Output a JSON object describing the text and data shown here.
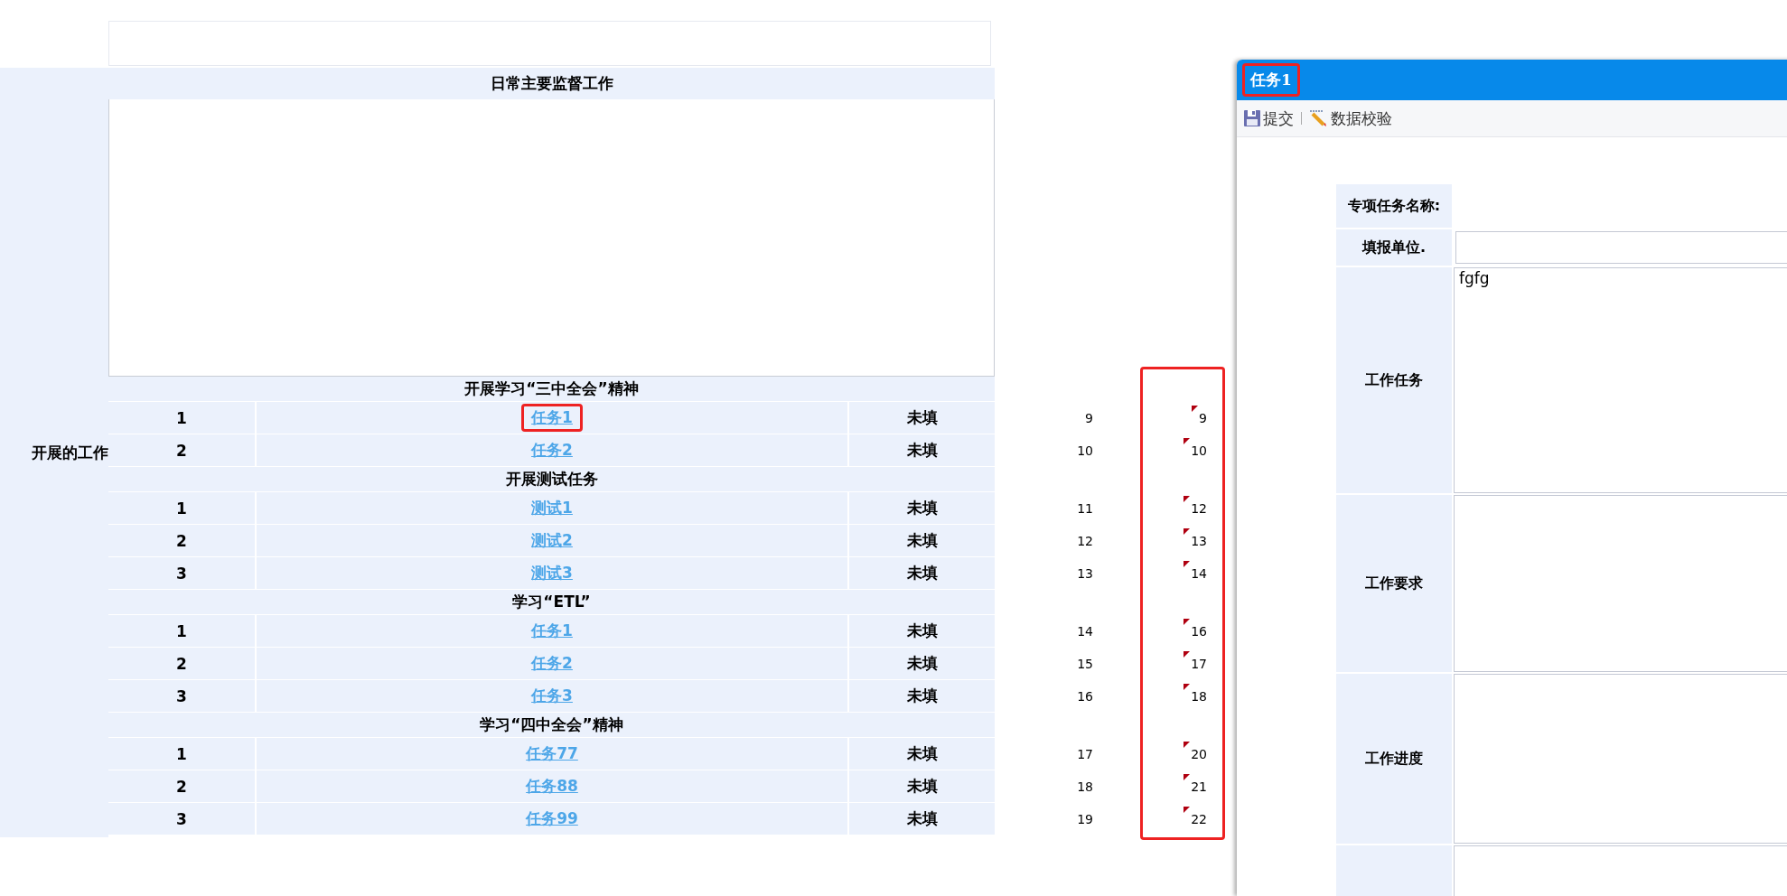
{
  "main_table": {
    "heading": "日常主要监督工作",
    "side_label": "开展的工作",
    "column_5_marked": true,
    "groups": [
      {
        "title": "开展学习“三中全会”精神",
        "rows": [
          {
            "index": "1",
            "task": "任务1",
            "status": "未填",
            "column_4": "9",
            "column_5": "9",
            "flagged": true,
            "marked": true
          },
          {
            "index": "2",
            "task": "任务2",
            "status": "未填",
            "column_4": "10",
            "column_5": "10",
            "flagged": true,
            "marked": false
          }
        ]
      },
      {
        "title": "开展测试任务",
        "rows": [
          {
            "index": "1",
            "task": "测试1",
            "status": "未填",
            "column_4": "11",
            "column_5": "12",
            "flagged": true,
            "marked": false
          },
          {
            "index": "2",
            "task": "测试2",
            "status": "未填",
            "column_4": "12",
            "column_5": "13",
            "flagged": true,
            "marked": false
          },
          {
            "index": "3",
            "task": "测试3",
            "status": "未填",
            "column_4": "13",
            "column_5": "14",
            "flagged": true,
            "marked": false
          }
        ]
      },
      {
        "title": "学习“ETL”",
        "rows": [
          {
            "index": "1",
            "task": "任务1",
            "status": "未填",
            "column_4": "14",
            "column_5": "16",
            "flagged": true,
            "marked": false
          },
          {
            "index": "2",
            "task": "任务2",
            "status": "未填",
            "column_4": "15",
            "column_5": "17",
            "flagged": true,
            "marked": false
          },
          {
            "index": "3",
            "task": "任务3",
            "status": "未填",
            "column_4": "16",
            "column_5": "18",
            "flagged": true,
            "marked": false
          }
        ]
      },
      {
        "title": "学习“四中全会”精神",
        "rows": [
          {
            "index": "1",
            "task": "任务77",
            "status": "未填",
            "column_4": "17",
            "column_5": "20",
            "flagged": true,
            "marked": false
          },
          {
            "index": "2",
            "task": "任务88",
            "status": "未填",
            "column_4": "18",
            "column_5": "21",
            "flagged": true,
            "marked": false
          },
          {
            "index": "3",
            "task": "任务99",
            "status": "未填",
            "column_4": "19",
            "column_5": "22",
            "flagged": true,
            "marked": false
          }
        ]
      }
    ]
  },
  "dialog": {
    "title": "任务1",
    "title_marked": true,
    "toolbar": [
      {
        "kind": "save",
        "label": "提交"
      },
      {
        "kind": "check",
        "label": "数据校验"
      }
    ],
    "form": [
      {
        "kind": "plain",
        "label": "专项任务名称:"
      },
      {
        "kind": "input",
        "label": "填报单位."
      },
      {
        "kind": "textarea",
        "label": "工作任务",
        "value": "fgfg"
      },
      {
        "kind": "textarea",
        "label": "工作要求"
      },
      {
        "kind": "textarea",
        "label": "工作进度"
      },
      {
        "kind": "textarea"
      }
    ]
  }
}
